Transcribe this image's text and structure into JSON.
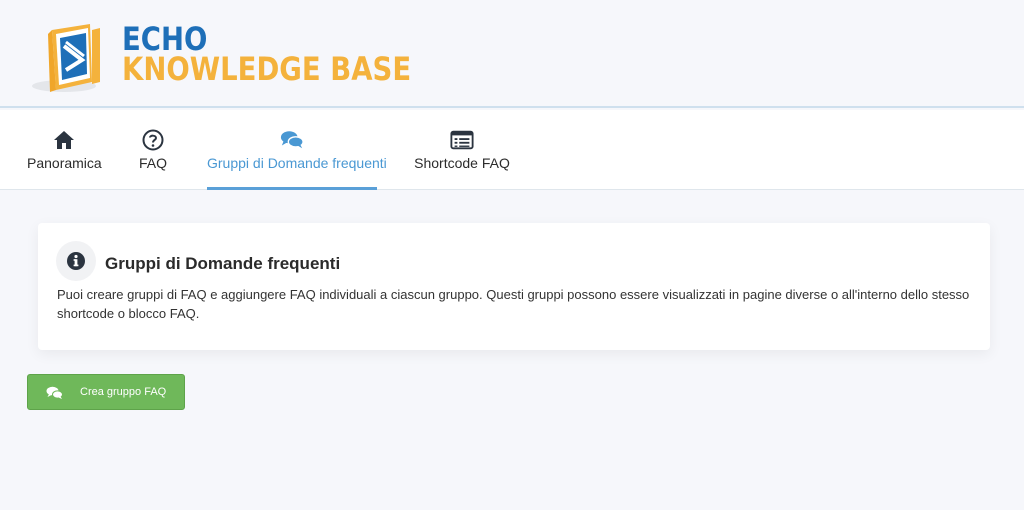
{
  "logo": {
    "line1": "ECHO",
    "line2": "KNOWLEDGE BASE"
  },
  "nav": {
    "tabs": [
      {
        "label": "Panoramica",
        "icon": "home-icon"
      },
      {
        "label": "FAQ",
        "icon": "question-circle-icon"
      },
      {
        "label": "Gruppi di Domande frequenti",
        "icon": "comments-icon",
        "active": true
      },
      {
        "label": "Shortcode FAQ",
        "icon": "list-alt-icon"
      }
    ]
  },
  "info_card": {
    "icon": "info-circle-icon",
    "title": "Gruppi di Domande frequenti",
    "description": "Puoi creare gruppi di FAQ e aggiungere FAQ individuali a ciascun gruppo. Questi gruppi possono essere visualizzati in pagine diverse o all'interno dello stesso shortcode o blocco FAQ."
  },
  "actions": {
    "create_label": "Crea gruppo FAQ",
    "create_icon": "comments-icon"
  },
  "colors": {
    "accent": "#4a98d3",
    "button": "#6fb85a",
    "logo_blue": "#1e6fb8",
    "logo_orange": "#f4b23c"
  }
}
